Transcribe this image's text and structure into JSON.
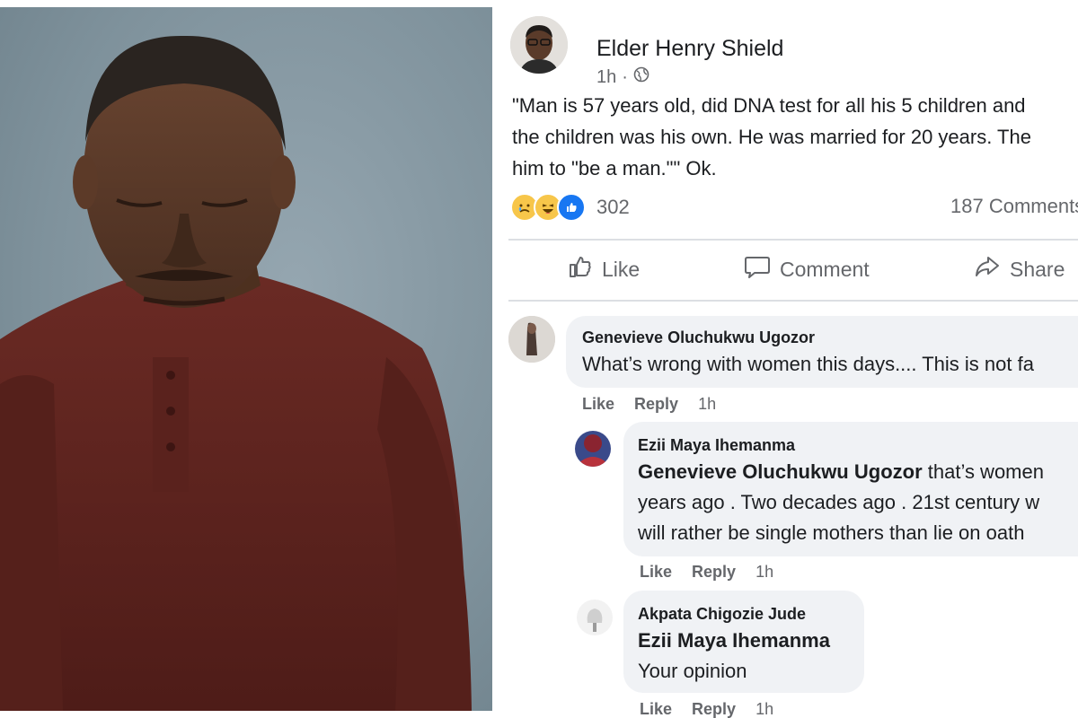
{
  "post": {
    "author": "Elder Henry Shield",
    "time": "1h",
    "privacy_icon": "globe-icon",
    "lines": [
      "\"Man is 57 years old, did DNA test for all his 5 children and",
      "the children was his own. He was married for 20 years. The",
      "him to \"be a man.\"\" Ok."
    ],
    "reaction_count": "302",
    "comments_count": "187 Comments"
  },
  "actions": {
    "like": "Like",
    "comment": "Comment",
    "share": "Share"
  },
  "comments": [
    {
      "name": "Genevieve Oluchukwu Ugozor",
      "lines": [
        "What’s wrong with women this days.... This is not fa"
      ],
      "like": "Like",
      "reply": "Reply",
      "time": "1h"
    },
    {
      "name": "Ezii Maya Ihemanma",
      "tag": "Genevieve Oluchukwu Ugozor",
      "first_rest": " that’s women",
      "lines": [
        "years ago . Two decades ago . 21st century w",
        "will rather be single mothers than lie on oath"
      ],
      "like": "Like",
      "reply": "Reply",
      "time": "1h"
    },
    {
      "name": "Akpata Chigozie Jude",
      "tag": "Ezii Maya Ihemanma",
      "lines": [
        "Your opinion"
      ],
      "like": "Like",
      "reply": "Reply",
      "time": "1h"
    }
  ],
  "colors": {
    "text": "#1c1e21",
    "muted": "#65676b",
    "bubble": "#f0f2f5",
    "like_blue": "#1877f2"
  }
}
